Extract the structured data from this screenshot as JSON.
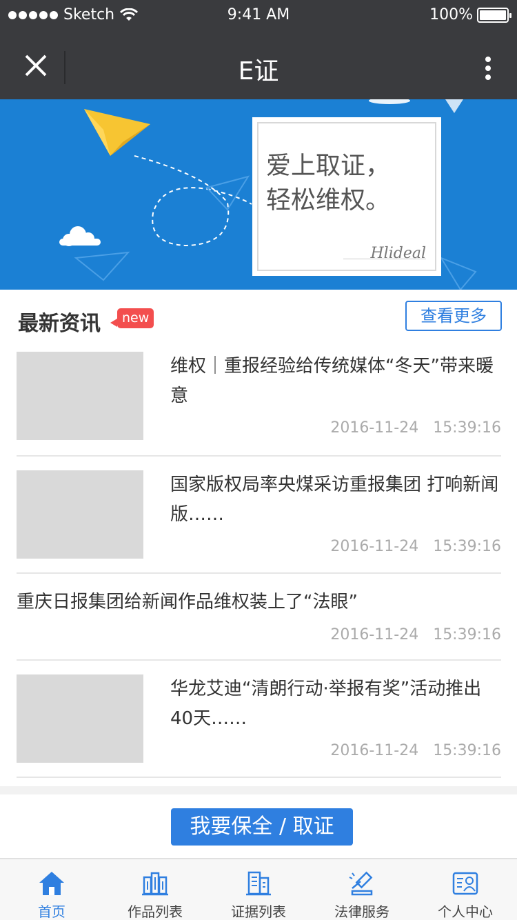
{
  "status_bar": {
    "carrier": "Sketch",
    "time": "9:41 AM",
    "battery": "100%"
  },
  "nav": {
    "title": "E证"
  },
  "banner": {
    "slogan_line1": "爱上取证，",
    "slogan_line2": "轻松维权。",
    "signature": "Hlideal"
  },
  "news": {
    "title": "最新资讯",
    "badge": "new",
    "more_label": "查看更多",
    "items": [
      {
        "title": "维权｜重报经验给传统媒体“冬天”带来暖意",
        "date": "2016-11-24   15:39:16"
      },
      {
        "title": "国家版权局率央煤采访重报集团  打响新闻版……",
        "date": "2016-11-24   15:39:16"
      },
      {
        "title": "重庆日报集团给新闻作品维权装上了“法眼”",
        "date": "2016-11-24   15:39:16"
      },
      {
        "title": "华龙艾迪“清朗行动·举报有奖”活动推出40天……",
        "date": "2016-11-24   15:39:16"
      }
    ]
  },
  "action": {
    "label": "我要保全 / 取证"
  },
  "tabs": [
    {
      "label": "首页",
      "icon": "home-icon"
    },
    {
      "label": "作品列表",
      "icon": "buildings-icon"
    },
    {
      "label": "证据列表",
      "icon": "evidence-icon"
    },
    {
      "label": "法律服务",
      "icon": "gavel-icon"
    },
    {
      "label": "个人中心",
      "icon": "profile-card-icon"
    }
  ],
  "colors": {
    "accent": "#2f7fe0",
    "banner": "#1b80d4",
    "header": "#3a3b3e",
    "badge": "#f34e4e"
  }
}
